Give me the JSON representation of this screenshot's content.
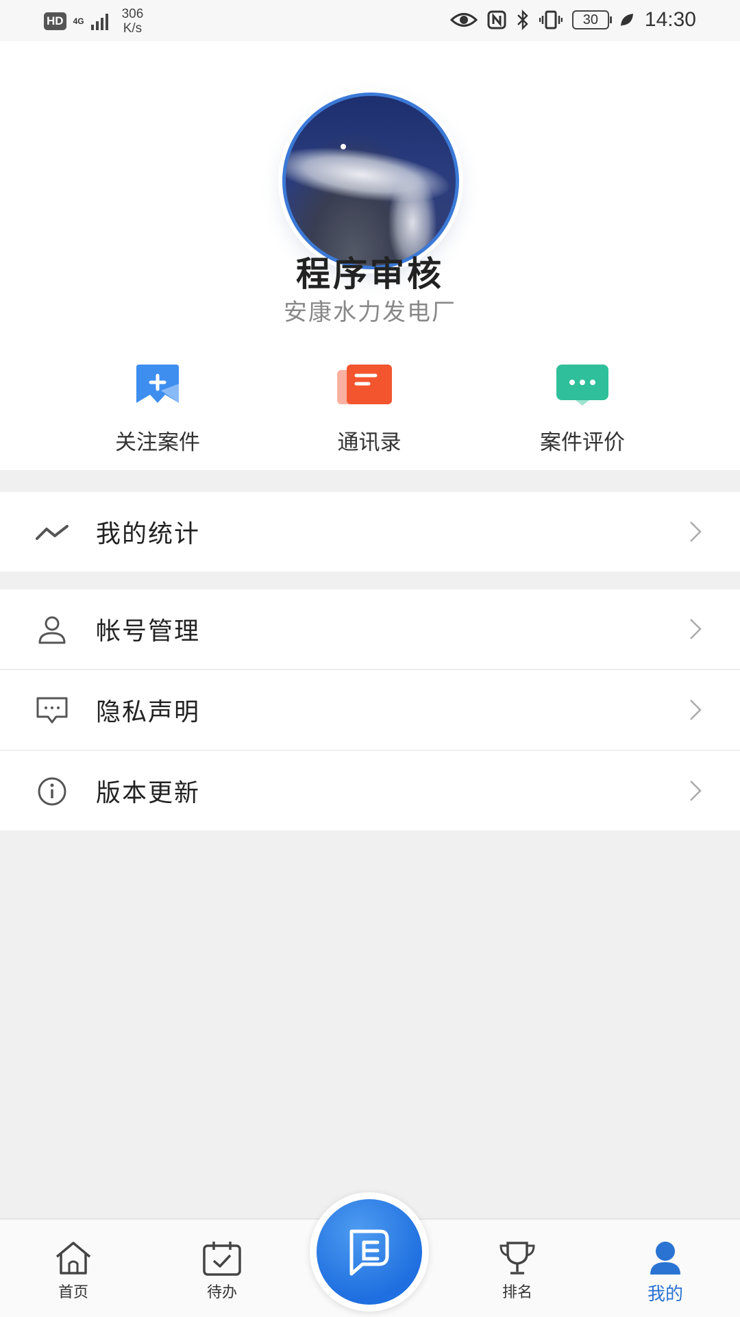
{
  "status_bar": {
    "hd": "HD",
    "network": "4G",
    "speed_value": "306",
    "speed_unit": "K/s",
    "battery": "30",
    "time": "14:30"
  },
  "profile": {
    "name": "程序审核",
    "organization": "安康水力发电厂"
  },
  "quick_actions": [
    {
      "label": "关注案件",
      "icon": "follow-case-icon",
      "color": "#3e8ef0"
    },
    {
      "label": "通讯录",
      "icon": "contacts-icon",
      "color": "#f3552e"
    },
    {
      "label": "案件评价",
      "icon": "case-review-icon",
      "color": "#2fbf9a"
    }
  ],
  "menu_groups": [
    [
      {
        "label": "我的统计",
        "icon": "statistics-icon"
      }
    ],
    [
      {
        "label": "帐号管理",
        "icon": "user-icon"
      },
      {
        "label": "隐私声明",
        "icon": "message-icon"
      },
      {
        "label": "版本更新",
        "icon": "info-icon"
      }
    ]
  ],
  "bottom_nav": {
    "tabs": [
      {
        "label": "首页",
        "icon": "home-icon"
      },
      {
        "label": "待办",
        "icon": "calendar-check-icon"
      },
      {
        "label": "",
        "icon": "center-action-icon"
      },
      {
        "label": "排名",
        "icon": "trophy-icon"
      },
      {
        "label": "我的",
        "icon": "profile-icon",
        "active": true
      }
    ],
    "active_color": "#2b73d3"
  }
}
